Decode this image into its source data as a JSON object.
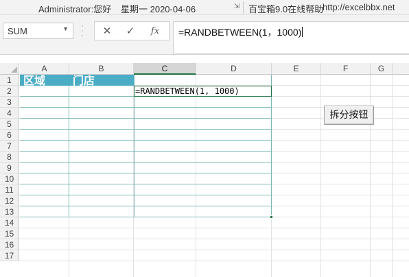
{
  "status_bar": {
    "user": "Administrator:您好",
    "date": "星期一  2020-04-06",
    "help": "百宝箱9.0在线帮助",
    "url": "http://excelbbx.net"
  },
  "formula_bar": {
    "name_box": "SUM",
    "cancel_icon": "✕",
    "enter_icon": "✓",
    "fx_label": "fx",
    "formula": "=RANDBETWEEN(1，1000)"
  },
  "columns": [
    "A",
    "B",
    "C",
    "D",
    "E",
    "F",
    "G"
  ],
  "rows": [
    "1",
    "2",
    "3",
    "4",
    "5",
    "6",
    "7",
    "8",
    "9",
    "10",
    "11",
    "12",
    "13",
    "14",
    "15",
    "16",
    "17"
  ],
  "cells": {
    "A1": "区域",
    "B1": "门店",
    "C2": "=RANDBETWEEN(1, 1000)"
  },
  "button": {
    "label": "拆分按钮"
  },
  "colors": {
    "header_fill": "#4bacc6",
    "table_border": "#7ab9b4",
    "accent": "#217346"
  }
}
